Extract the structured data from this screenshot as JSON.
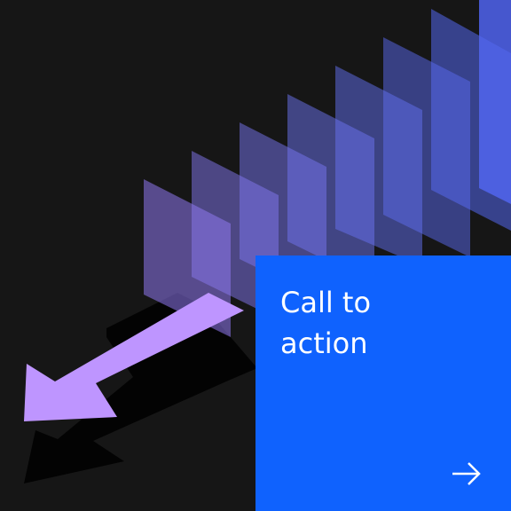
{
  "cta": {
    "title": "Call to\naction",
    "arrow_icon": "arrow-right-icon"
  },
  "colors": {
    "background": "#161616",
    "tile": "#0f62fe",
    "text": "#ffffff",
    "panel_top": "#5a6cf2",
    "panel_bottom": "#9a6ef0",
    "arrow": "#be95ff",
    "shadow": "#000000"
  }
}
